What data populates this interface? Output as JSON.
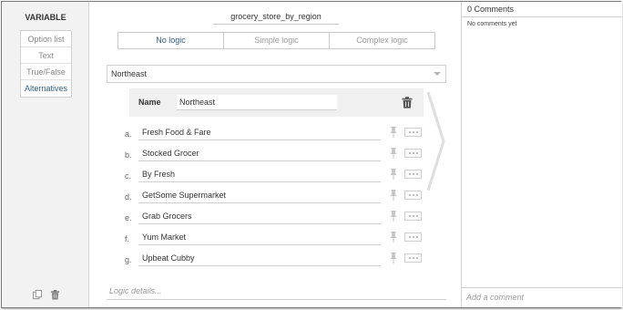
{
  "sidebar": {
    "title": "VARIABLE",
    "types": [
      {
        "label": "Option list",
        "active": false
      },
      {
        "label": "Text",
        "active": false
      },
      {
        "label": "True/False",
        "active": false
      },
      {
        "label": "Alternatives",
        "active": true
      }
    ],
    "footer_icons": [
      "copy-icon",
      "trash-icon"
    ]
  },
  "editor": {
    "variable_name": "grocery_store_by_region",
    "logic_tabs": [
      {
        "label": "No logic",
        "active": true
      },
      {
        "label": "Simple logic",
        "active": false
      },
      {
        "label": "Complex logic",
        "active": false
      }
    ],
    "selected_group": "Northeast",
    "name_label": "Name",
    "name_value": "Northeast",
    "alternatives": [
      {
        "letter": "a.",
        "value": "Fresh Food & Fare"
      },
      {
        "letter": "b.",
        "value": "Stocked Grocer"
      },
      {
        "letter": "c.",
        "value": "By Fresh"
      },
      {
        "letter": "d.",
        "value": "GetSome Supermarket"
      },
      {
        "letter": "e.",
        "value": "Grab Grocers"
      },
      {
        "letter": "f.",
        "value": "Yum Market"
      },
      {
        "letter": "g.",
        "value": "Upbeat Cubby"
      }
    ],
    "logic_details_placeholder": "Logic details..."
  },
  "comments": {
    "title": "0 Comments",
    "empty_text": "No comments yet",
    "add_placeholder": "Add a comment"
  },
  "colors": {
    "accent": "#2f5f8a",
    "panel_bg": "#f2f2f2",
    "border": "#cfcfcf"
  }
}
